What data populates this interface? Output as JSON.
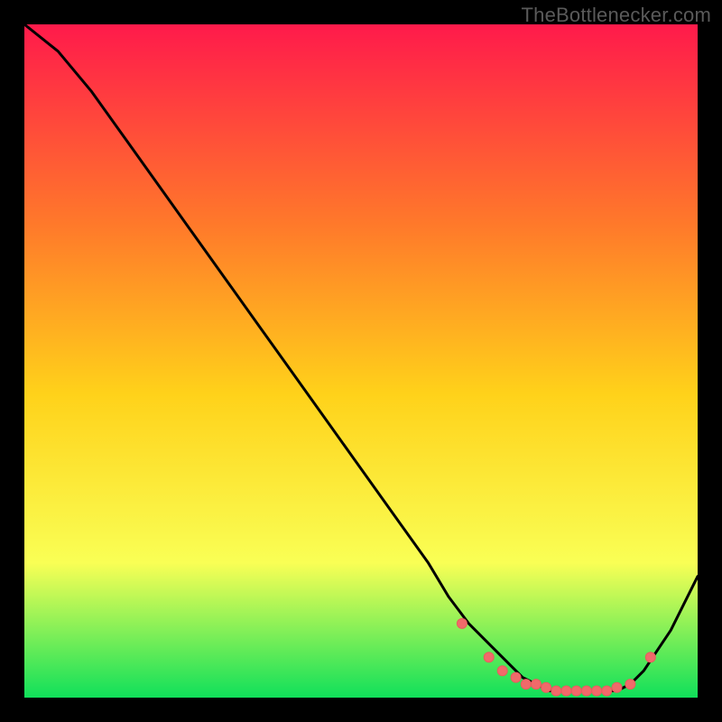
{
  "watermark": "TheBottlenecker.com",
  "colors": {
    "background": "#000000",
    "gradient_top": "#ff1a4b",
    "gradient_upper_mid": "#ff7a2a",
    "gradient_mid": "#ffd21a",
    "gradient_lower_mid": "#f9ff55",
    "gradient_bottom": "#10e05a",
    "curve": "#000000",
    "marker_fill": "#f06a6a",
    "marker_stroke": "#e85d5d",
    "watermark_text": "#5a5a5a"
  },
  "chart_data": {
    "type": "line",
    "title": "",
    "xlabel": "",
    "ylabel": "",
    "xlim": [
      0,
      100
    ],
    "ylim": [
      0,
      100
    ],
    "series": [
      {
        "name": "bottleneck-curve",
        "x": [
          0,
          5,
          10,
          15,
          20,
          25,
          30,
          35,
          40,
          45,
          50,
          55,
          60,
          63,
          66,
          69,
          72,
          74,
          76,
          78,
          80,
          82,
          84,
          86,
          88,
          90,
          92,
          94,
          96,
          98,
          100
        ],
        "y": [
          100,
          96,
          90,
          83,
          76,
          69,
          62,
          55,
          48,
          41,
          34,
          27,
          20,
          15,
          11,
          8,
          5,
          3,
          2,
          1,
          1,
          1,
          1,
          1,
          1,
          2,
          4,
          7,
          10,
          14,
          18
        ]
      }
    ],
    "markers": {
      "name": "highlight-points",
      "x": [
        65,
        69,
        71,
        73,
        74.5,
        76,
        77.5,
        79,
        80.5,
        82,
        83.5,
        85,
        86.5,
        88,
        90,
        93
      ],
      "y": [
        11,
        6,
        4,
        3,
        2,
        2,
        1.5,
        1,
        1,
        1,
        1,
        1,
        1,
        1.5,
        2,
        6
      ]
    }
  }
}
